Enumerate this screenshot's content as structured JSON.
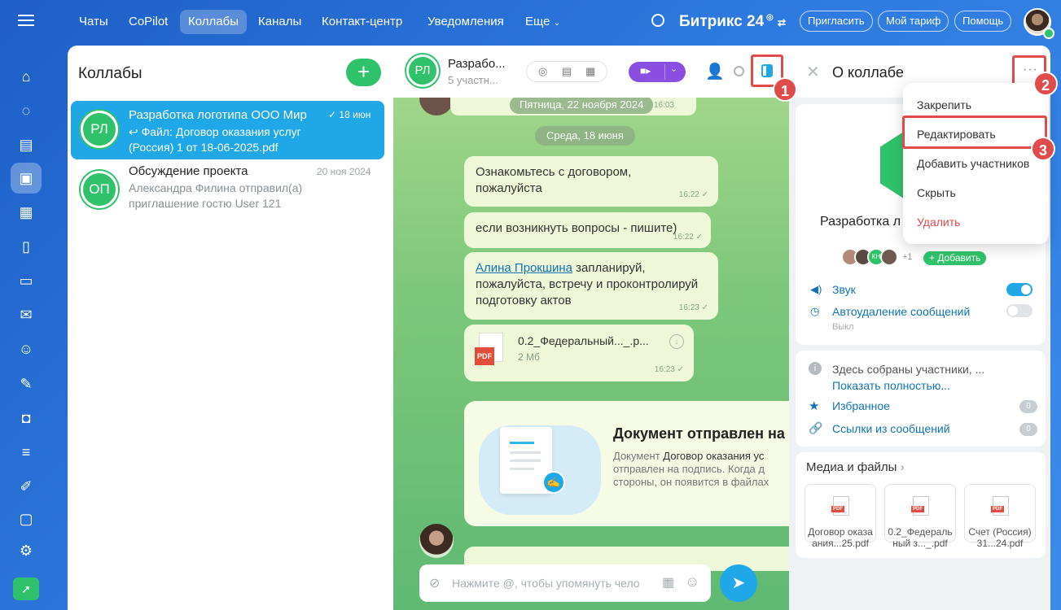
{
  "topnav": {
    "tabs": [
      "Чаты",
      "CoPilot",
      "Коллабы",
      "Каналы",
      "Контакт-центр",
      "Уведомления",
      "Еще"
    ],
    "brand": "Битрикс 24",
    "invite": "Пригласить",
    "tariff": "Мой тариф",
    "help": "Помощь"
  },
  "list": {
    "title": "Коллабы",
    "items": [
      {
        "avatar": "РЛ",
        "title": "Разработка логотипа ООО Мир",
        "date": "18 июн",
        "preview": "↩ Файл: Договор оказания услуг (Россия) 1 от 18-06-2025.pdf"
      },
      {
        "avatar": "ОП",
        "title": "Обсуждение проекта",
        "date": "20 ноя 2024",
        "preview": "Александра Филина отправил(а) приглашение гостю User 121"
      }
    ]
  },
  "chat": {
    "avatar": "РЛ",
    "title": "Разрабо...",
    "subtitle": "5 участн...",
    "date_old": "Пятница, 22 ноября 2024",
    "date_new": "Среда, 18 июня",
    "msg1": "Ознакомьтесь с договором, пожалуйста",
    "msg1_time": "16:22",
    "msg2": "если возникнуть вопросы - пишите)",
    "msg2_time": "16:22",
    "msg3_mention": "Алина Прокшина",
    "msg3_text": " запланируй, пожалуйста, встречу и проконтролируй подготовку актов",
    "msg3_time": "16:23",
    "file_name": "0.2_Федеральный..._.p...",
    "file_size": "2 Мб",
    "file_time": "16:23",
    "doc_title": "Документ отправлен на",
    "doc_text_prefix": "Документ ",
    "doc_text_name": "Договор оказания ус",
    "doc_text_rest": "отправлен на подпись. Когда д стороны, он появится в файлах",
    "input_placeholder": "Нажмите @, чтобы упомянуть чело",
    "old_time": "16:03"
  },
  "right": {
    "title": "О коллабе",
    "name": "Разработка л",
    "plus_count": "+1",
    "add_label": "+ Добавить",
    "sound": "Звук",
    "autodelete": "Автоудаление сообщений",
    "autodelete_state": "Выкл",
    "info_text": "Здесь собраны участники, ...",
    "show_more": "Показать полностью...",
    "favorites": "Избранное",
    "favorites_count": "0",
    "links": "Ссылки из сообщений",
    "links_count": "0",
    "media_title": "Медиа и файлы",
    "files": [
      "Договор оказа ания...25.pdf",
      "0.2_Федераль ный з..._.pdf",
      "Счет (Россия) 31...24.pdf"
    ],
    "member_initials": "КН"
  },
  "menu": {
    "items": [
      "Закрепить",
      "Редактировать",
      "Добавить участников",
      "Скрыть",
      "Удалить"
    ]
  },
  "steps": [
    "1",
    "2",
    "3"
  ],
  "colors": {
    "accent": "#2fc26a",
    "selected": "#1fa7e8",
    "danger": "#e04b4b",
    "purple": "#8a4fe0"
  }
}
